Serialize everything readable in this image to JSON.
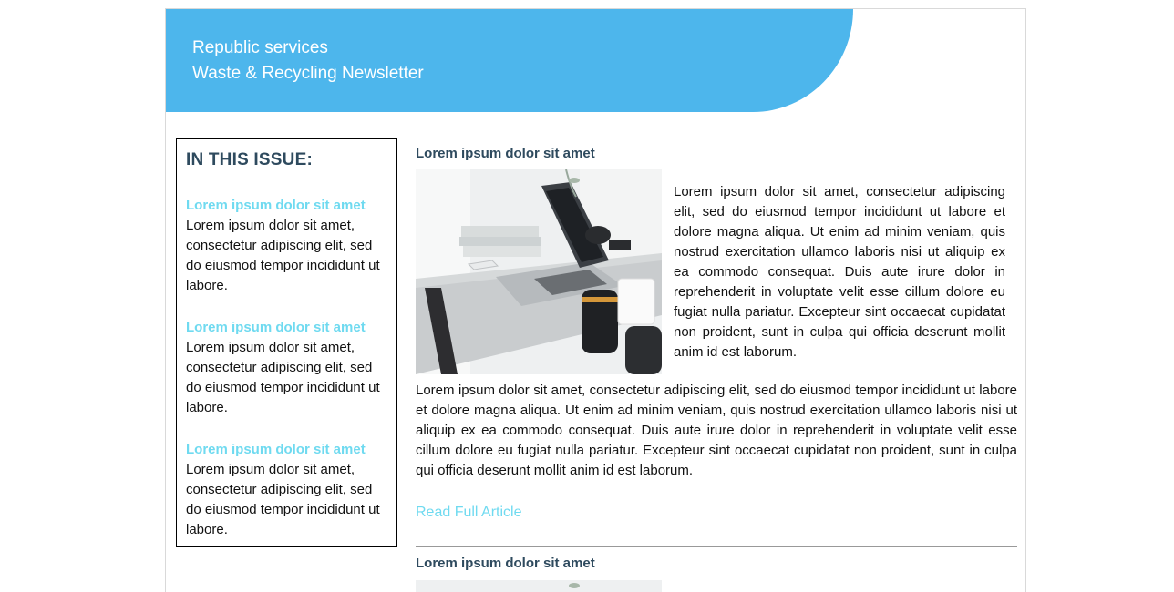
{
  "header": {
    "line1": "Republic services",
    "line2": "Waste & Recycling Newsletter",
    "band_color": "#4db6ec"
  },
  "sidebar": {
    "title": "IN THIS ISSUE:",
    "items": [
      {
        "heading": "Lorem ipsum dolor sit amet",
        "text": "Lorem ipsum dolor sit amet, consectetur adipiscing elit, sed do eiusmod tempor incididunt ut labore."
      },
      {
        "heading": "Lorem ipsum dolor sit amet",
        "text": "Lorem ipsum dolor sit amet, consectetur adipiscing elit, sed do eiusmod tempor incididunt ut labore."
      },
      {
        "heading": "Lorem ipsum dolor sit amet",
        "text": "Lorem ipsum dolor sit amet, consectetur adipiscing elit, sed do eiusmod tempor incididunt ut labore."
      }
    ]
  },
  "articles": [
    {
      "title": "Lorem ipsum dolor sit amet",
      "image_icon": "laptop-desk-photo",
      "side_text": "Lorem ipsum dolor sit amet, consectetur adipiscing elit, sed do eiusmod tempor incididunt ut labore et dolore magna aliqua. Ut enim ad minim veniam, quis nostrud exercitation ullamco laboris nisi ut aliquip ex ea commodo consequat. Duis aute irure dolor in reprehenderit in voluptate velit esse cillum dolore eu fugiat nulla pariatur. Excepteur sint occaecat cupidatat non proident, sunt in culpa qui officia deserunt mollit anim id est laborum.",
      "body": "Lorem ipsum dolor sit amet, consectetur adipiscing elit, sed do eiusmod tempor incididunt ut labore et dolore magna aliqua. Ut enim ad minim veniam, quis nostrud exercitation ullamco laboris nisi ut aliquip ex ea commodo consequat. Duis aute irure dolor in reprehenderit in voluptate velit esse cillum dolore eu fugiat nulla pariatur. Excepteur sint occaecat cupidatat non proident, sunt in culpa qui officia deserunt mollit anim id est laborum.",
      "read_more": "Read Full Article"
    },
    {
      "title": "Lorem ipsum dolor sit amet"
    }
  ],
  "colors": {
    "accent_link": "#6fdaf0",
    "heading": "#2e4a5e"
  }
}
